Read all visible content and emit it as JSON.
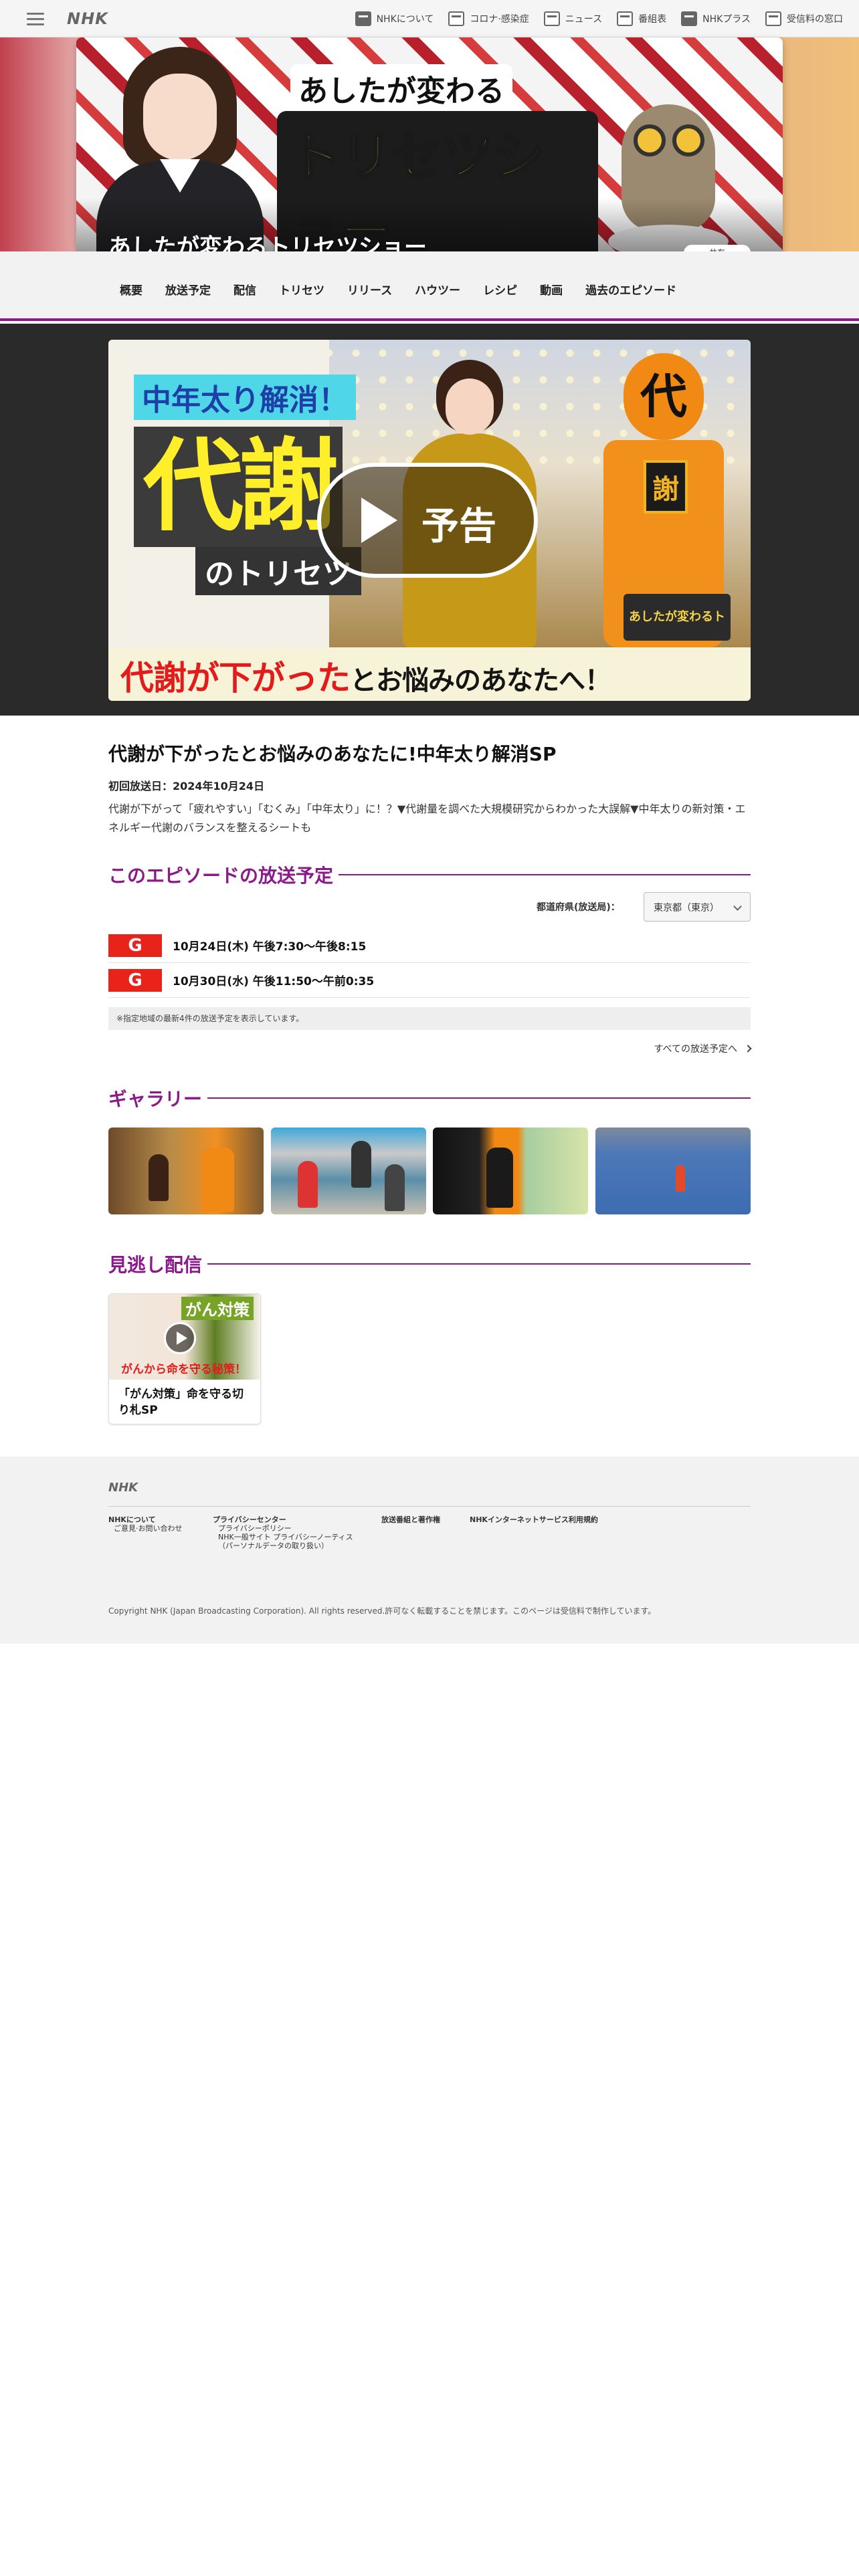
{
  "header": {
    "logo": "NHK",
    "links": [
      {
        "label": "NHKについて",
        "icon": "nhk-icon"
      },
      {
        "label": "コロナ·感染症",
        "icon": "virus-icon"
      },
      {
        "label": "ニュース",
        "icon": "news-icon"
      },
      {
        "label": "番組表",
        "icon": "grid-icon"
      },
      {
        "label": "NHKプラス",
        "icon": "plus-icon"
      },
      {
        "label": "受信料の窓口",
        "icon": "tv-icon"
      }
    ]
  },
  "hero": {
    "title_top": "あしたが変わる",
    "title_main": "トリセツショー",
    "program_name": "あしたが変わるトリセツショー",
    "share_label": "共有"
  },
  "nav": {
    "items": [
      "概要",
      "放送予定",
      "配信",
      "トリセツ",
      "リリース",
      "ハウツー",
      "レシピ",
      "動画",
      "過去のエピソード"
    ]
  },
  "video": {
    "tag_top": "中年太り解消！",
    "tag_big": "代謝",
    "tag_sub": "のトリセツ",
    "caption_red": "代謝が下がった",
    "caption_black": "とお悩みのあなたへ！",
    "mascot_head": "代",
    "mascot_badge": "謝",
    "logo_text": "あしたが変わるトリセツショー",
    "play_label": "予告"
  },
  "episode": {
    "title": "代謝が下がったとお悩みのあなたに!中年太り解消SP",
    "first_air": "初回放送日：2024年10月24日",
    "description": "代謝が下がって「疲れやすい」「むくみ」「中年太り」に！？▼代謝量を調べた大規模研究からわかった大誤解▼中年太りの新対策・エネルギー代謝のバランスを整えるシートも"
  },
  "schedule": {
    "heading": "このエピソードの放送予定",
    "pref_label": "都道府県(放送局)：",
    "pref_value": "東京都（東京）",
    "rows": [
      {
        "channel": "G",
        "time": "10月24日(木) 午後7:30〜午後8:15"
      },
      {
        "channel": "G",
        "time": "10月30日(水) 午後11:50〜午前0:35"
      }
    ],
    "note": "※指定地域の最新4件の放送予定を表示しています。",
    "all_link": "すべての放送予定へ"
  },
  "gallery": {
    "heading": "ギャラリー"
  },
  "vod": {
    "heading": "見逃し配信",
    "card_badge": "がん対策",
    "card_sub": "がんから命を守る秘策！",
    "card_title": "「がん対策」命を守る切り札SP"
  },
  "footer": {
    "logo": "NHK",
    "col1": {
      "head": "NHKについて",
      "sub": "ご意見·お問い合わせ"
    },
    "col2": {
      "head": "プライバシーセンター",
      "subs": [
        "プライバシーポリシー",
        "NHK一般サイト プライバシーノーティス",
        "（パーソナルデータの取り扱い）"
      ]
    },
    "col3": {
      "head": "放送番組と著作権"
    },
    "col4": {
      "head": "NHKインターネットサービス利用規約"
    },
    "copyright": "Copyright NHK (Japan Broadcasting Corporation). All rights reserved.許可なく転載することを禁じます。このページは受信料で制作しています。"
  },
  "colors": {
    "accent": "#8a1a8a",
    "channel_g": "#e8241a"
  }
}
